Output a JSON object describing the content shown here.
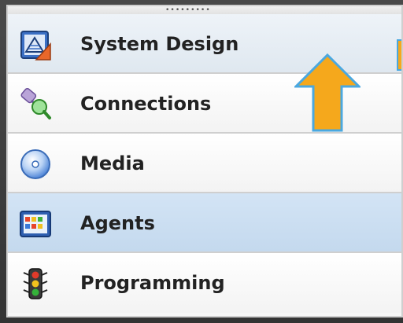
{
  "panel": {
    "grip_dots": "•••••••••",
    "items": [
      {
        "label": "System Design",
        "icon": "system-design-icon",
        "state": "hover"
      },
      {
        "label": "Connections",
        "icon": "connections-icon",
        "state": "normal"
      },
      {
        "label": "Media",
        "icon": "media-icon",
        "state": "normal"
      },
      {
        "label": "Agents",
        "icon": "agents-icon",
        "state": "selected"
      },
      {
        "label": "Programming",
        "icon": "programming-icon",
        "state": "normal"
      }
    ]
  },
  "annotation": {
    "arrow_color": "#f5a81c",
    "arrow_outline": "#4aa8e0",
    "icon": "up-arrow-icon"
  }
}
